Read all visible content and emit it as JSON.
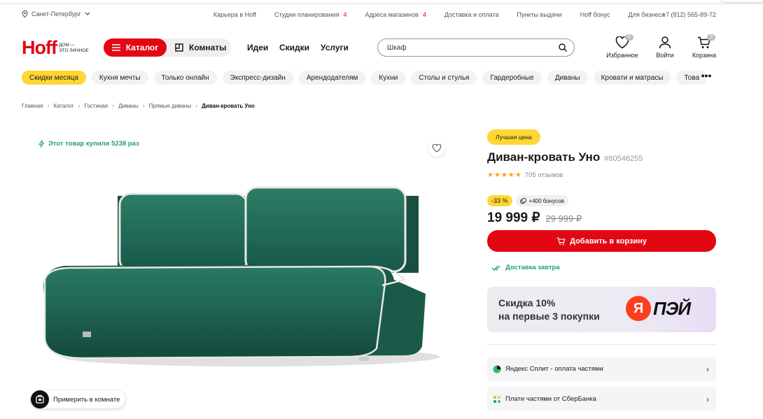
{
  "topbar": {
    "city": "Санкт-Петербург",
    "links": [
      {
        "label": "Карьера в Hoff",
        "count": ""
      },
      {
        "label": "Студии планирования",
        "count": "4"
      },
      {
        "label": "Адреса магазинов",
        "count": "4"
      },
      {
        "label": "Доставка и оплата",
        "count": ""
      },
      {
        "label": "Пункты выдачи",
        "count": ""
      },
      {
        "label": "Hoff бонус",
        "count": ""
      },
      {
        "label": "Для бизнеса",
        "count": ""
      }
    ],
    "phone": "+7 (812) 565-89-72"
  },
  "header": {
    "logo_word": "Hoff",
    "logo_tagline_1": "ДОМ —",
    "logo_tagline_2": "ЭТО ЛИЧНОЕ",
    "catalog_label": "Каталог",
    "rooms_label": "Комнаты",
    "nav": [
      "Идеи",
      "Скидки",
      "Услуги"
    ],
    "search_value": "Шкаф",
    "favorites_label": "Избранное",
    "favorites_count": "0",
    "login_label": "Войти",
    "cart_label": "Корзина",
    "cart_count": "0"
  },
  "chips": [
    "Скидки месяца",
    "Кухня мечты",
    "Только онлайн",
    "Экспресс-дизайн",
    "Арендодателям",
    "Кухни",
    "Столы и стулья",
    "Гардеробные",
    "Диваны",
    "Кровати и матрасы",
    "Това"
  ],
  "breadcrumbs": [
    "Главная",
    "Каталог",
    "Гостиная",
    "Диваны",
    "Прямые диваны",
    "Диван-кровать Уно"
  ],
  "gallery": {
    "bought_text": "Этот товар купили 5238 раз",
    "try_in_room": "Примерить в комнате"
  },
  "product": {
    "badge": "Лучшая цена",
    "title": "Диван-кровать Уно",
    "sku": "#80546255",
    "rating": 5,
    "reviews": "705 отзывов",
    "discount": "-33 %",
    "bonus": "+400 бонусов",
    "price": "19 999 ₽",
    "old_price": "29 999 ₽",
    "add_to_cart": "Добавить в корзину",
    "delivery": "Доставка завтра"
  },
  "promo": {
    "line1": "Скидка 10%",
    "line2": "на первые 3 покупки",
    "logo_letter": "Я",
    "logo_text": "ПЭЙ"
  },
  "payments": [
    {
      "label": "Яндекс Сплит - оплата частями",
      "icon": "yandex-split-icon"
    },
    {
      "label": "Плати частями от СберБанка",
      "icon": "sber-icon"
    }
  ],
  "colors": {
    "accent": "#e30613",
    "highlight": "#ffd633",
    "success": "#1e9e77",
    "sofa": "#1f5e4d"
  }
}
